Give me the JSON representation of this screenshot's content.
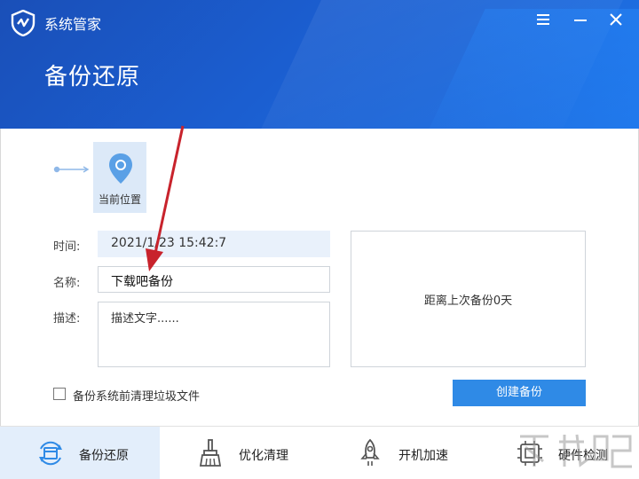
{
  "app": {
    "title": "系统管家"
  },
  "page": {
    "title": "备份还原"
  },
  "location": {
    "label": "当前位置"
  },
  "form": {
    "time_label": "时间:",
    "time_value": "2021/1/23  15:42:7",
    "name_label": "名称:",
    "name_value": "下载吧备份",
    "desc_label": "描述:",
    "desc_value": "描述文字......"
  },
  "info": {
    "text": "距离上次备份0天"
  },
  "option": {
    "label": "备份系统前清理垃圾文件",
    "checked": false
  },
  "actions": {
    "create_label": "创建备份"
  },
  "nav": [
    {
      "label": "备份还原",
      "icon": "backup-restore-icon",
      "active": true
    },
    {
      "label": "优化清理",
      "icon": "broom-icon",
      "active": false
    },
    {
      "label": "开机加速",
      "icon": "rocket-icon",
      "active": false
    },
    {
      "label": "硬件检测",
      "icon": "chip-icon",
      "active": false
    }
  ],
  "colors": {
    "header": "#1b5ed0",
    "accent": "#2f8ae6",
    "active_tab": "#e3eefb",
    "annotation_arrow": "#c8232c"
  }
}
